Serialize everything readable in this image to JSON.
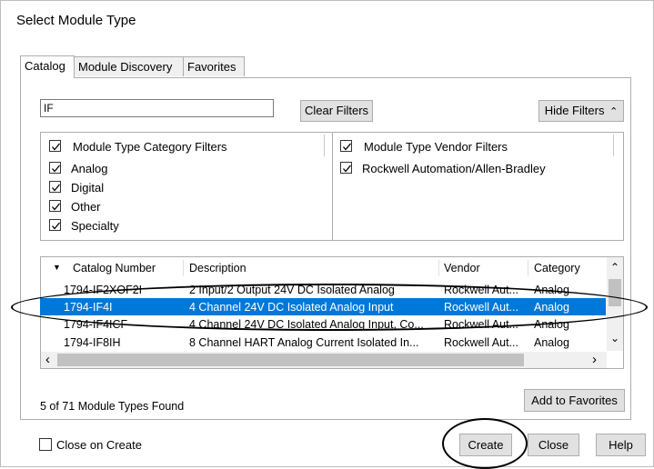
{
  "dialog": {
    "title": "Select Module Type"
  },
  "tabs": [
    {
      "label": "Catalog",
      "active": true
    },
    {
      "label": "Module Discovery",
      "active": false
    },
    {
      "label": "Favorites",
      "active": false
    }
  ],
  "search": {
    "value": "IF"
  },
  "buttons": {
    "clear_filters": "Clear Filters",
    "hide_filters": "Hide Filters",
    "add_to_favorites": "Add to Favorites",
    "create": "Create",
    "close": "Close",
    "help": "Help"
  },
  "category_filters": {
    "header": "Module Type Category Filters",
    "items": [
      "Analog",
      "Digital",
      "Other",
      "Specialty"
    ]
  },
  "vendor_filters": {
    "header": "Module Type Vendor Filters",
    "items": [
      "Rockwell Automation/Allen-Bradley"
    ]
  },
  "table": {
    "columns": [
      "Catalog Number",
      "Description",
      "Vendor",
      "Category"
    ],
    "rows": [
      [
        "1794-IF2XOF2I",
        "2 Input/2 Output 24V DC Isolated Analog",
        "Rockwell Aut...",
        "Analog"
      ],
      [
        "1794-IF4I",
        "4 Channel 24V DC Isolated Analog Input",
        "Rockwell Aut...",
        "Analog"
      ],
      [
        "1794-IF4ICF",
        "4 Channel 24V DC Isolated Analog Input, Co...",
        "Rockwell Aut...",
        "Analog"
      ],
      [
        "1794-IF8IH",
        "8 Channel HART Analog Current Isolated In...",
        "Rockwell Aut...",
        "Analog"
      ]
    ],
    "selected_row": 1
  },
  "status": "5 of 71 Module Types Found",
  "close_on_create": {
    "label": "Close on Create",
    "checked": false
  },
  "colors": {
    "selection": "#0078d7",
    "button_face": "#e1e1e1",
    "border": "#adadad"
  }
}
